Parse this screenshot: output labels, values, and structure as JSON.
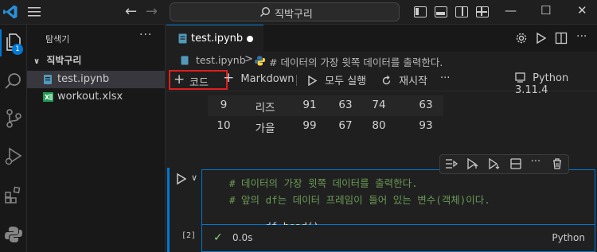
{
  "titlebar": {
    "search_text": "직박구리",
    "back_glyph": "←",
    "forward_glyph": "→",
    "minimize_glyph": "—",
    "maximize_glyph": "☐",
    "close_glyph": "✕"
  },
  "activity": {
    "badge_count": "1"
  },
  "sidebar": {
    "title": "탐색기",
    "more": "···",
    "folder": "직박구리",
    "files": [
      {
        "label": "test.ipynb",
        "icon": "notebook-icon",
        "selected": true
      },
      {
        "label": "workout.xlsx",
        "icon": "excel-icon",
        "selected": false
      }
    ]
  },
  "editor": {
    "tab_label": "test.ipynb",
    "breadcrumb": {
      "file": "test.ipynb",
      "separator": ">",
      "cell": "# 데이터의 가장 윗쪽 데이터를 출력한다."
    },
    "toolbar": {
      "code": "코드",
      "markdown": "Markdown",
      "run_all": "모두 실행",
      "restart": "재시작",
      "more": "···",
      "kernel": "Python 3.11.4"
    },
    "table": {
      "rows": [
        [
          "9",
          "리즈",
          "91",
          "63",
          "74",
          "63"
        ],
        [
          "10",
          "가을",
          "99",
          "67",
          "80",
          "93"
        ]
      ]
    },
    "cell": {
      "exec_count": "[2]",
      "lines": [
        "# 데이터의 가장 윗쪽 데이터를 출력한다.",
        "# 앞의 df는 데이터 프레임이 들어 있는 변수(객체)이다."
      ],
      "code_var": "df",
      "code_method": ".head",
      "code_parens": "()",
      "status_time": "0.0s",
      "language": "Python"
    }
  },
  "colors": {
    "accent": "#0078d4",
    "highlight_box": "#e01e1e",
    "comment": "#6a9955"
  }
}
